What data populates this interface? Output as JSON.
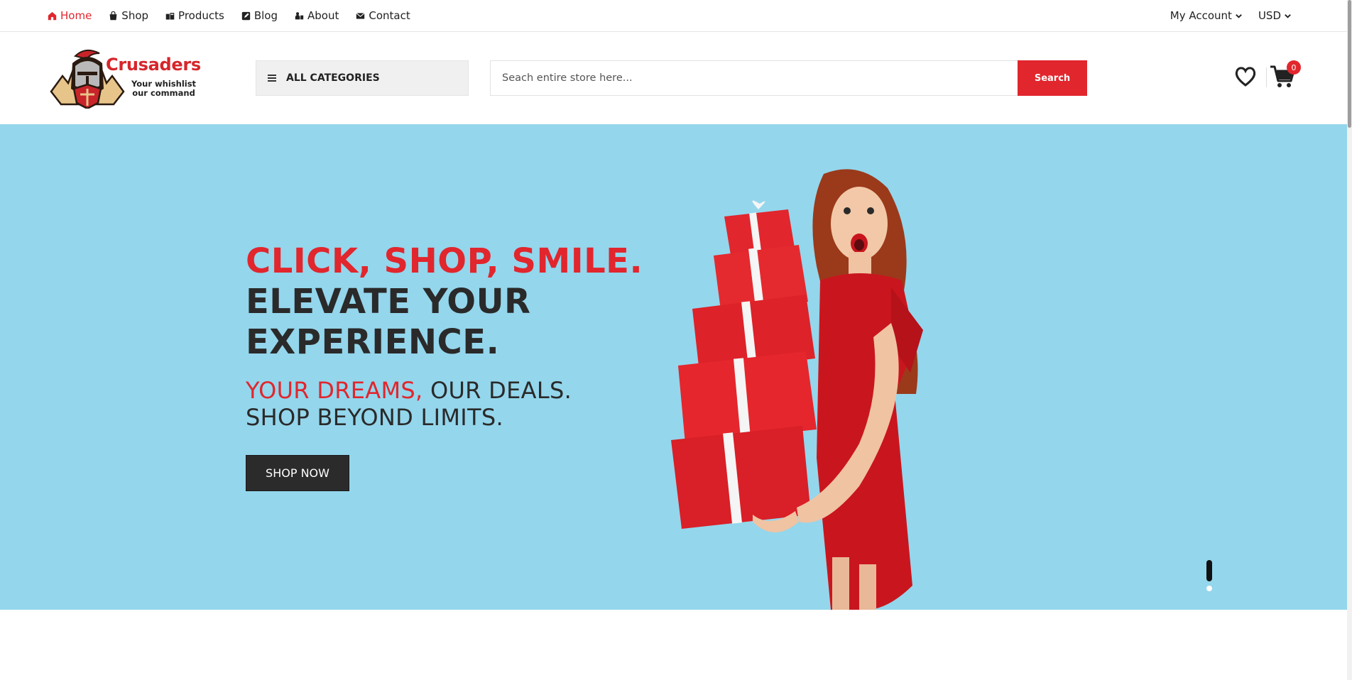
{
  "topnav": {
    "items": [
      {
        "label": "Home",
        "icon": "home-icon",
        "active": true
      },
      {
        "label": "Shop",
        "icon": "shopping-bag-icon",
        "active": false
      },
      {
        "label": "Products",
        "icon": "boxes-icon",
        "active": false
      },
      {
        "label": "Blog",
        "icon": "edit-icon",
        "active": false
      },
      {
        "label": "About",
        "icon": "people-icon",
        "active": false
      },
      {
        "label": "Contact",
        "icon": "envelope-icon",
        "active": false
      }
    ],
    "account_label": "My Account",
    "currency_label": "USD"
  },
  "header": {
    "brand_name": "Crusaders",
    "tagline_line1": "Your whishlist",
    "tagline_line2": "our command",
    "categories_label": "ALL CATEGORIES",
    "search_placeholder": "Seach entire store here...",
    "search_button": "Search",
    "cart_count": "0"
  },
  "hero": {
    "headline_line1": "CLICK, SHOP, SMILE.",
    "headline_line2": "ELEVATE YOUR",
    "headline_line3": "EXPERIENCE.",
    "sub_red": "YOUR DREAMS,",
    "sub_dark": " OUR DEALS.",
    "sub_line2": "SHOP BEYOND LIMITS.",
    "cta_label": "SHOP NOW",
    "slides_total": 2,
    "active_slide": 1
  },
  "colors": {
    "accent": "#e1262d",
    "hero_bg": "#94d6ec",
    "dark": "#2b2b2b"
  }
}
